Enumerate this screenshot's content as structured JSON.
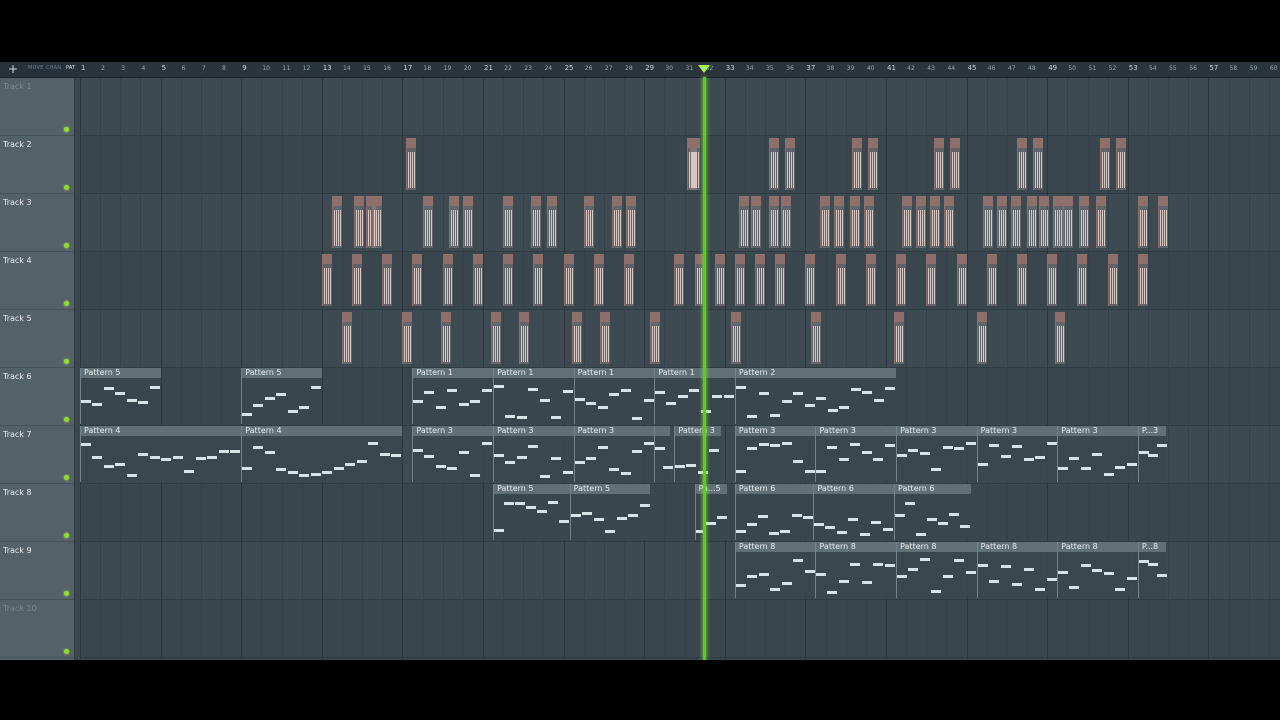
{
  "toolbar": {
    "add_label": "+",
    "tool_labels": [
      "MOVE",
      "CHAN",
      "PAT"
    ]
  },
  "ruler": {
    "bars": [
      "1",
      "2",
      "3",
      "4",
      "5",
      "6",
      "7",
      "8",
      "9",
      "10",
      "11",
      "12",
      "13",
      "14",
      "15",
      "16",
      "17",
      "18",
      "19",
      "20",
      "21",
      "22",
      "23",
      "24",
      "25",
      "26",
      "27",
      "28",
      "29",
      "30",
      "31",
      "32",
      "33",
      "34",
      "35",
      "36",
      "37",
      "38",
      "39",
      "40",
      "41",
      "42",
      "43",
      "44",
      "45",
      "46",
      "47",
      "48",
      "49",
      "50",
      "51",
      "52",
      "53",
      "54",
      "55",
      "56",
      "57",
      "58",
      "59",
      "60"
    ],
    "major_bars": [
      "1",
      "5",
      "9",
      "13",
      "17",
      "21",
      "25",
      "29",
      "33",
      "37",
      "41",
      "45",
      "49",
      "53",
      "57"
    ]
  },
  "tracks": [
    {
      "name": "Track 1",
      "dim": true
    },
    {
      "name": "Track 2"
    },
    {
      "name": "Track 3"
    },
    {
      "name": "Track 4"
    },
    {
      "name": "Track 5"
    },
    {
      "name": "Track 6"
    },
    {
      "name": "Track 7"
    },
    {
      "name": "Track 8"
    },
    {
      "name": "Track 9"
    },
    {
      "name": "Track 10",
      "dim": true
    }
  ],
  "playhead_bar": 31.9,
  "colors": {
    "playhead": "#57d018",
    "led": "#8edc2b",
    "audio_header": "#8f6f6c",
    "pattern_header": "#616f77"
  },
  "pattern_clips": [
    {
      "track": 5,
      "bar": 1,
      "len": 4,
      "label": "Pattern 5"
    },
    {
      "track": 5,
      "bar": 9,
      "len": 4,
      "label": "Pattern 5"
    },
    {
      "track": 5,
      "bar": 17.5,
      "len": 4,
      "label": "Pattern 1"
    },
    {
      "track": 5,
      "bar": 21.5,
      "len": 4,
      "label": "Pattern 1"
    },
    {
      "track": 5,
      "bar": 25.5,
      "len": 4,
      "label": "Pattern 1"
    },
    {
      "track": 5,
      "bar": 29.5,
      "len": 4,
      "label": "Pattern 1"
    },
    {
      "track": 5,
      "bar": 33.5,
      "len": 8,
      "label": "Pattern 2"
    },
    {
      "track": 6,
      "bar": 1,
      "len": 8,
      "label": "Pattern 4"
    },
    {
      "track": 6,
      "bar": 9,
      "len": 8,
      "label": "Pattern 4"
    },
    {
      "track": 6,
      "bar": 17.5,
      "len": 4,
      "label": "Pattern 3"
    },
    {
      "track": 6,
      "bar": 21.5,
      "len": 4,
      "label": "Pattern 3"
    },
    {
      "track": 6,
      "bar": 25.5,
      "len": 4,
      "label": "Pattern 3"
    },
    {
      "track": 6,
      "bar": 29.5,
      "len": 0.8,
      "label": ""
    },
    {
      "track": 6,
      "bar": 30.5,
      "len": 2.3,
      "label": "Pattern 3"
    },
    {
      "track": 6,
      "bar": 33.5,
      "len": 4,
      "label": "Pattern 3"
    },
    {
      "track": 6,
      "bar": 37.5,
      "len": 4,
      "label": "Pattern 3"
    },
    {
      "track": 6,
      "bar": 41.5,
      "len": 4,
      "label": "Pattern 3"
    },
    {
      "track": 6,
      "bar": 45.5,
      "len": 4,
      "label": "Pattern 3"
    },
    {
      "track": 6,
      "bar": 49.5,
      "len": 4,
      "label": "Pattern 3"
    },
    {
      "track": 6,
      "bar": 53.5,
      "len": 1.4,
      "label": "P...3"
    },
    {
      "track": 7,
      "bar": 21.5,
      "len": 3.8,
      "label": "Pattern 5"
    },
    {
      "track": 7,
      "bar": 25.3,
      "len": 4,
      "label": "Pattern 5"
    },
    {
      "track": 7,
      "bar": 31.5,
      "len": 1.6,
      "label": "Pa...5"
    },
    {
      "track": 7,
      "bar": 33.5,
      "len": 3.9,
      "label": "Pattern 6"
    },
    {
      "track": 7,
      "bar": 37.4,
      "len": 4,
      "label": "Pattern 6"
    },
    {
      "track": 7,
      "bar": 41.4,
      "len": 3.8,
      "label": "Pattern 6"
    },
    {
      "track": 8,
      "bar": 33.5,
      "len": 4,
      "label": "Pattern 8"
    },
    {
      "track": 8,
      "bar": 37.5,
      "len": 4,
      "label": "Pattern 8"
    },
    {
      "track": 8,
      "bar": 41.5,
      "len": 4,
      "label": "Pattern 8"
    },
    {
      "track": 8,
      "bar": 45.5,
      "len": 4,
      "label": "Pattern 8"
    },
    {
      "track": 8,
      "bar": 49.5,
      "len": 4,
      "label": "Pattern 8"
    },
    {
      "track": 8,
      "bar": 53.5,
      "len": 1.4,
      "label": "P...8"
    }
  ],
  "audio_clips": [
    {
      "track": 1,
      "bars": [
        17.2,
        31.1,
        31.25,
        35.2,
        36.0,
        39.3,
        40.1,
        43.4,
        44.2,
        47.5,
        48.3,
        51.6,
        52.4
      ]
    },
    {
      "track": 2,
      "bars": [
        13.5,
        14.6,
        15.2,
        15.5,
        18.0,
        19.3,
        20.0,
        22.0,
        23.4,
        24.2,
        26.0,
        27.4,
        28.1,
        33.7,
        34.3,
        35.2,
        35.8,
        37.7,
        38.4,
        39.2,
        39.9,
        41.8,
        42.5,
        43.2,
        43.9,
        45.8,
        46.5,
        47.2,
        48.0,
        48.6,
        49.3,
        49.8,
        50.6,
        51.4,
        53.5,
        54.5
      ]
    },
    {
      "track": 3,
      "bars": [
        13.0,
        14.5,
        16.0,
        17.5,
        19.0,
        20.5,
        22.0,
        23.5,
        25.0,
        26.5,
        28.0,
        30.5,
        31.5,
        32.5,
        33.5,
        34.5,
        35.5,
        37.0,
        38.5,
        40.0,
        41.5,
        43.0,
        44.5,
        46.0,
        47.5,
        49.0,
        50.5,
        52.0,
        53.5
      ]
    },
    {
      "track": 4,
      "bars": [
        14.0,
        17.0,
        18.9,
        21.4,
        22.8,
        25.4,
        26.8,
        29.3,
        33.3,
        37.3,
        41.4,
        45.5,
        49.4
      ]
    }
  ]
}
